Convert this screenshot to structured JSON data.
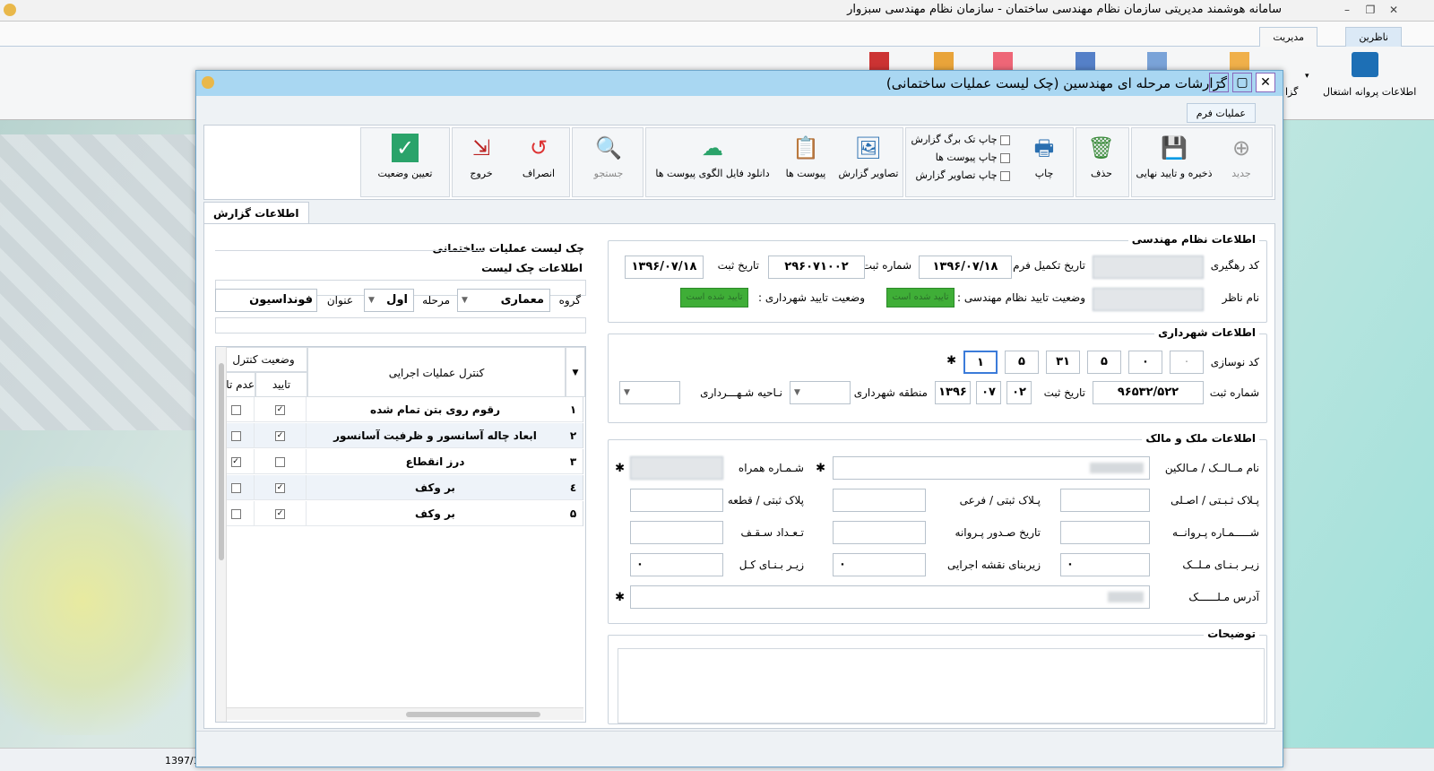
{
  "app": {
    "title": "سامانه هوشمند مدیریتی سازمان نظام مهندسی  ساختمان - سازمان نظام مهندسی سبزوار",
    "tabs": [
      "ناظرین",
      "مدیریت"
    ],
    "ribbon_item": "اطلاعات پروانه اشتغال",
    "ribbon_item2": "گزا",
    "status_date": "1397/1"
  },
  "dialog": {
    "title": "گزارشات مرحله ای مهندسین (چک لیست عملیات ساختمانی)",
    "ops_tab": "عملیات فرم",
    "toolbar": {
      "new": "جدید",
      "save": "ذخیره و تایید نهایی",
      "delete": "حذف",
      "print": "چاپ",
      "print_single": "چاپ تک برگ گزارش",
      "print_attach": "چاپ پیوست ها",
      "print_images": "چاپ تصاویر گزارش",
      "report_images": "تصاویر گزارش",
      "attachments": "پیوست ها",
      "download_template": "دانلود فایل الگوی پیوست ها",
      "search": "جستجو",
      "cancel": "انصراف",
      "exit": "خروج",
      "set_status": "تعیین وضعیت"
    },
    "report_tab": "اطلاعات گزارش"
  },
  "engineering": {
    "title": "اطلاعات نظام مهندسی",
    "tracking_code_label": "کد رهگیری",
    "form_date_label": "تاریخ تکمیل فرم",
    "form_date": "۱۳۹۶/۰۷/۱۸",
    "reg_no_label": "شماره ثبت",
    "reg_no": "۲۹۶۰۷۱۰۰۲",
    "reg_date_label": "تاریخ ثبت",
    "reg_date": "۱۳۹۶/۰۷/۱۸",
    "supervisor_label": "نام ناظر",
    "eng_status_label": "وضعیت تایید نظام مهندسی :",
    "eng_status": "تایید شده است",
    "muni_status_label": "وضعیت تایید شهرداری :",
    "muni_status": "تایید شده است"
  },
  "municipality": {
    "title": "اطلاعات شهرداری",
    "renovation_label": "کد نوسازی",
    "code_parts": [
      "۰",
      "۰",
      "۵",
      "۳۱",
      "۵",
      "۱"
    ],
    "reg_no_label": "شماره ثبت",
    "reg_no": "۹۶۵۳۲/۵۲۲",
    "reg_date_label": "تاریخ ثبت",
    "reg_day": "۰۲",
    "reg_month": "۰۷",
    "reg_year": "۱۳۹۶",
    "zone_label": "منطقه شهرداری",
    "district_label": "نـاحیه شـهـــرداری"
  },
  "property": {
    "title": "اطلاعات ملک و مالک",
    "owner_label": "نام مــالــک / مـالکین",
    "mobile_label": "شـمـاره همراه",
    "plate_main_label": "پـلاک ثـبـتی / اصـلی",
    "plate_sub_label": "پـلاک ثبتی / فرعی",
    "plate_piece_label": "پلاک ثبتی / قطعه",
    "license_no_label": "شـــــمـاره پـروانــه",
    "license_date_label": "تاریخ صـدور پـروانه",
    "floors_label": "تـعـداد سـقـف",
    "land_area_label": "زیـر بـنـای مـلــک",
    "exec_area_label": "زیربنای نقشه اجرایی",
    "total_area_label": "زیـر بـنـای کـل",
    "address_label": "آدرس مـلــــــک",
    "zero": "۰"
  },
  "notes": {
    "title": "توضیحات"
  },
  "checklist": {
    "title": "چک لیست عملیات ساختمانی",
    "info_title": "اطلاعات چک لیست",
    "group_label": "گروه",
    "group_value": "معماری",
    "stage_label": "مرحله",
    "stage_value": "اول",
    "subject_label": "عنوان",
    "subject_value": "فونداسیون",
    "col_control": "کنترل عملیات اجرایی",
    "col_status": "وضعیت کنترل",
    "col_approve": "تایید",
    "col_reject": "عدم تایی",
    "rows": [
      {
        "num": "۱",
        "text": "رقوم روی بتن تمام شده",
        "approve": "✓",
        "reject": ""
      },
      {
        "num": "۲",
        "text": "ابعاد چاله آسانسور و ظرفیت آسانسور",
        "approve": "✓",
        "reject": ""
      },
      {
        "num": "۳",
        "text": "درز انقطاع",
        "approve": "",
        "reject": "✓"
      },
      {
        "num": "٤",
        "text": "بر وکف",
        "approve": "✓",
        "reject": ""
      },
      {
        "num": "۵",
        "text": "بر وکف",
        "approve": "✓",
        "reject": ""
      }
    ]
  },
  "colors": {
    "title_bar": "#a9d7f2",
    "status_green": "#3fae37"
  }
}
